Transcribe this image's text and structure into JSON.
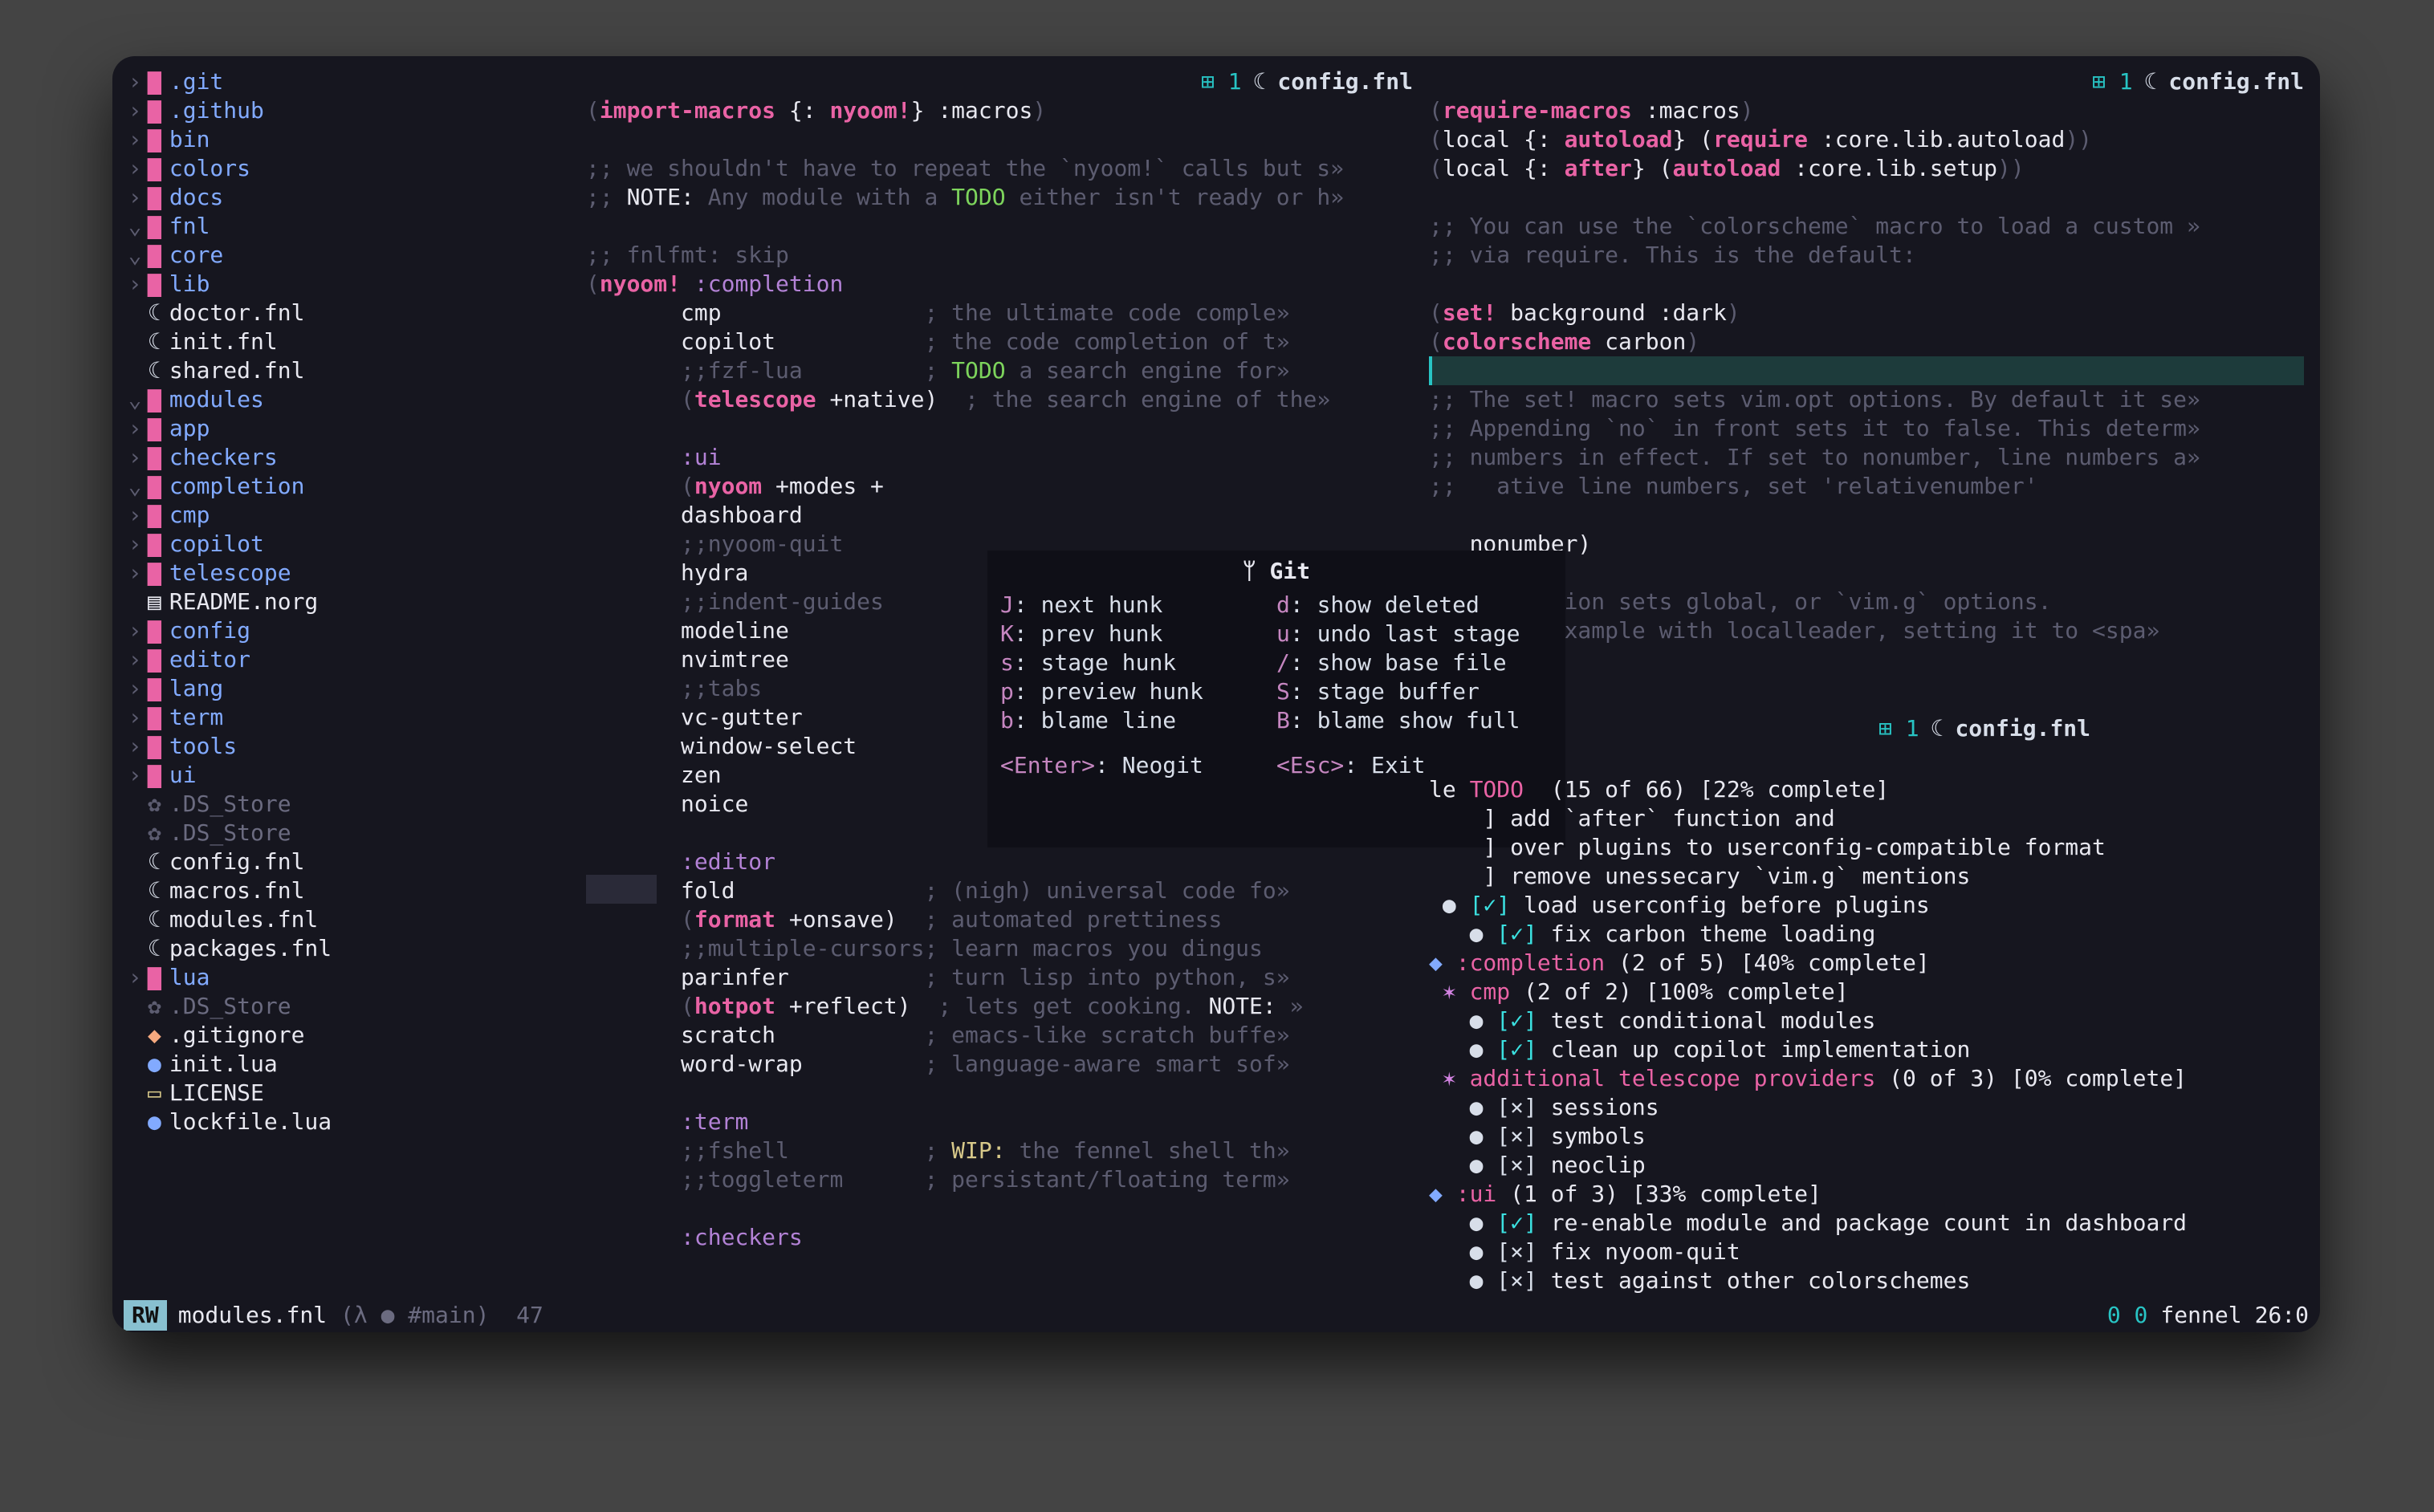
{
  "tabs": {
    "left": {
      "badge": "⊞ 1",
      "moon": "☾",
      "name": "config.fnl"
    },
    "right": {
      "badge": "⊞ 1",
      "moon": "☾",
      "name": "config.fnl"
    },
    "todo": {
      "badge": "⊞ 1",
      "moon": "☾",
      "name": "config.fnl"
    }
  },
  "tree": [
    {
      "d": 0,
      "t": "folder",
      "arrow": "›",
      "label": ".git"
    },
    {
      "d": 0,
      "t": "folder",
      "arrow": "›",
      "label": ".github"
    },
    {
      "d": 0,
      "t": "folder",
      "arrow": "›",
      "label": "bin"
    },
    {
      "d": 0,
      "t": "folder",
      "arrow": "›",
      "label": "colors"
    },
    {
      "d": 0,
      "t": "folder",
      "arrow": "›",
      "label": "docs"
    },
    {
      "d": 0,
      "t": "folder-open",
      "arrow": "⌄",
      "label": "fnl"
    },
    {
      "d": 1,
      "t": "folder-open",
      "arrow": "⌄",
      "label": "core"
    },
    {
      "d": 2,
      "t": "folder",
      "arrow": "›",
      "label": "lib"
    },
    {
      "d": 2,
      "t": "fnl",
      "arrow": " ",
      "label": "doctor.fnl"
    },
    {
      "d": 2,
      "t": "fnl",
      "arrow": " ",
      "label": "init.fnl"
    },
    {
      "d": 2,
      "t": "fnl",
      "arrow": " ",
      "label": "shared.fnl"
    },
    {
      "d": 1,
      "t": "folder-open",
      "arrow": "⌄",
      "label": "modules"
    },
    {
      "d": 2,
      "t": "folder",
      "arrow": "›",
      "label": "app"
    },
    {
      "d": 2,
      "t": "folder",
      "arrow": "›",
      "label": "checkers"
    },
    {
      "d": 2,
      "t": "folder-open",
      "arrow": "⌄",
      "label": "completion"
    },
    {
      "d": 3,
      "t": "folder",
      "arrow": "›",
      "label": "cmp"
    },
    {
      "d": 3,
      "t": "folder",
      "arrow": "›",
      "label": "copilot"
    },
    {
      "d": 3,
      "t": "folder",
      "arrow": "›",
      "label": "telescope"
    },
    {
      "d": 3,
      "t": "file",
      "arrow": " ",
      "label": "README.norg"
    },
    {
      "d": 2,
      "t": "folder",
      "arrow": "›",
      "label": "config"
    },
    {
      "d": 2,
      "t": "folder",
      "arrow": "›",
      "label": "editor"
    },
    {
      "d": 2,
      "t": "folder",
      "arrow": "›",
      "label": "lang"
    },
    {
      "d": 2,
      "t": "folder",
      "arrow": "›",
      "label": "term"
    },
    {
      "d": 2,
      "t": "folder",
      "arrow": "›",
      "label": "tools"
    },
    {
      "d": 2,
      "t": "folder",
      "arrow": "›",
      "label": "ui"
    },
    {
      "d": 2,
      "t": "gear",
      "arrow": " ",
      "label": ".DS_Store"
    },
    {
      "d": 1,
      "t": "gear",
      "arrow": " ",
      "label": ".DS_Store"
    },
    {
      "d": 1,
      "t": "fnl",
      "arrow": " ",
      "label": "config.fnl"
    },
    {
      "d": 1,
      "t": "fnl",
      "arrow": " ",
      "label": "macros.fnl"
    },
    {
      "d": 1,
      "t": "fnl",
      "arrow": " ",
      "label": "modules.fnl"
    },
    {
      "d": 1,
      "t": "fnl",
      "arrow": " ",
      "label": "packages.fnl"
    },
    {
      "d": 0,
      "t": "folder",
      "arrow": "›",
      "label": "lua"
    },
    {
      "d": 0,
      "t": "gear",
      "arrow": " ",
      "label": ".DS_Store"
    },
    {
      "d": 0,
      "t": "orange",
      "arrow": " ",
      "label": ".gitignore"
    },
    {
      "d": 0,
      "t": "blue",
      "arrow": " ",
      "label": "init.lua"
    },
    {
      "d": 0,
      "t": "yellow",
      "arrow": " ",
      "label": "LICENSE"
    },
    {
      "d": 0,
      "t": "blue",
      "arrow": " ",
      "label": "lockfile.lua"
    }
  ],
  "left_code": {
    "l1a": "(",
    "l1b": "import-macros",
    "l1c": " {: ",
    "l1d": "nyoom!",
    "l1e": "} ",
    "l1f": ":macros",
    "l1g": ")",
    "l3": ";; we shouldn't have to repeat the `nyoom!` calls but s»",
    "l4a": ";; ",
    "l4b": "NOTE:",
    "l4c": " Any module with a ",
    "l4d": "TODO",
    "l4e": " either isn't ready or h»",
    "l6": ";; fnlfmt: skip",
    "l7a": "(",
    "l7b": "nyoom!",
    "l7c": " :completion",
    "l8": "cmp",
    "l8c": "; the ultimate code comple»",
    "l9": "copilot",
    "l9c": "; the code completion of t»",
    "l10": ";;fzf-lua",
    "l10c": "; ",
    "l10t": "TODO",
    "l10d": " a search engine for»",
    "l11a": "(",
    "l11b": "telescope",
    "l11c": " +native)",
    "l11d": "; the search engine of the»",
    "l13": ":ui",
    "l14a": "(",
    "l14b": "nyoom",
    "l14c": " +modes +",
    "l15": "dashboard",
    "l16": ";;nyoom-quit",
    "l17": "hydra",
    "l18": ";;indent-guides",
    "l19": "modeline",
    "l20": "nvimtree",
    "l21": ";;tabs",
    "l22": "vc-gutter",
    "l23": "window-select",
    "l24": "zen",
    "l25": "noice",
    "l27": ":editor",
    "l28": "fold",
    "l28c": "; (nigh) universal code fo»",
    "l29a": "(",
    "l29b": "format",
    "l29c": " +onsave)",
    "l29d": "; automated prettiness",
    "l30": ";;multiple-cursors",
    "l30c": "; learn macros you dingus",
    "l31": "parinfer",
    "l31c": "; turn lisp into python, s»",
    "l32a": "(",
    "l32b": "hotpot",
    "l32c": " +reflect)",
    "l32d": "; lets get cooking. ",
    "l32e": "NOTE:",
    "l32f": " »",
    "l33": "scratch",
    "l33c": "; emacs-like scratch buffe»",
    "l34": "word-wrap",
    "l34c": "; language-aware smart sof»",
    "l36": ":term",
    "l37": ";;fshell",
    "l37c": "; ",
    "l37w": "WIP:",
    "l37d": " the fennel shell th»",
    "l38": ";;toggleterm",
    "l38c": "; persistant/floating term»",
    "l40": ":checkers"
  },
  "right_code": {
    "l1a": "(",
    "l1b": "require-macros",
    "l1c": " ",
    "l1d": ":macros",
    "l1e": ")",
    "l2a": "(local {: ",
    "l2b": "autoload",
    "l2c": "} (",
    "l2d": "require",
    "l2e": " :core.lib.autoload",
    "l2f": "))",
    "l3a": "(local {: ",
    "l3b": "after",
    "l3c": "} (",
    "l3d": "autoload",
    "l3e": " :core.lib.setup",
    "l3f": "))",
    "l5": ";; You can use the `colorscheme` macro to load a custom »",
    "l6": ";; via require. This is the default:",
    "l8a": "(",
    "l8b": "set!",
    "l8c": " background ",
    "l8d": ":dark",
    "l8e": ")",
    "l9a": "(",
    "l9b": "colorscheme",
    "l9c": " carbon",
    "l9d": ")",
    "l11": ";; The set! macro sets vim.opt options. By default it se»",
    "l12": ";; Appending `no` in front sets it to false. This determ»",
    "l13": ";; numbers in effect. If set to nonumber, line numbers a»",
    "l14": ";;   ative line numbers, set 'relativenumber'",
    "l16": "   nonumber)",
    "l18": "   let option sets global, or `vim.g` options.",
    "l19": "   es an example with localleader, setting it to <spa»"
  },
  "popup": {
    "title": "Git",
    "left": [
      {
        "k": "J",
        "t": "next hunk"
      },
      {
        "k": "K",
        "t": "prev hunk"
      },
      {
        "k": "s",
        "t": "stage hunk"
      },
      {
        "k": "p",
        "t": "preview hunk"
      },
      {
        "k": "b",
        "t": "blame line"
      }
    ],
    "right": [
      {
        "k": "d",
        "t": "show deleted"
      },
      {
        "k": "u",
        "t": "undo last stage"
      },
      {
        "k": "/",
        "t": "show base file"
      },
      {
        "k": "S",
        "t": "stage buffer"
      },
      {
        "k": "B",
        "t": "blame show full"
      }
    ],
    "foot1k": "<Enter>",
    "foot1t": ": Neogit",
    "foot2k": "<Esc>",
    "foot2t": ": Exit"
  },
  "todo": {
    "h": "le ",
    "hT": "TODO",
    "hR": "  (15 of 66) [22% complete]",
    "i1": "] add `after` function and",
    "i2": "] over plugins to userconfig-compatible format",
    "i3": "] remove unessecary `vim.g` mentions",
    "c1": "load userconfig before plugins",
    "c2": "fix carbon theme loading",
    "s_comp": ":completion",
    "s_compR": " (2 of 5) [40% complete]",
    "s_cmp": "cmp",
    "s_cmpR": " (2 of 2) [100% complete]",
    "c3": "test conditional modules",
    "c4": "clean up copilot implementation",
    "s_tel": "additional telescope providers",
    "s_telR": " (0 of 3) [0% complete]",
    "x1": "sessions",
    "x2": "symbols",
    "x3": "neoclip",
    "s_ui": ":ui",
    "s_uiR": " (1 of 3) [33% complete]",
    "c5": "re-enable module and package count in dashboard",
    "x4": "fix nyoom-quit",
    "x5": "test against other colorschemes"
  },
  "status": {
    "rw": "RW",
    "file": "modules.fnl",
    "meta": "(λ ● #main)",
    "ln": "47",
    "diag": "0 0",
    "ft": "fennel",
    "pos": "26:0"
  }
}
